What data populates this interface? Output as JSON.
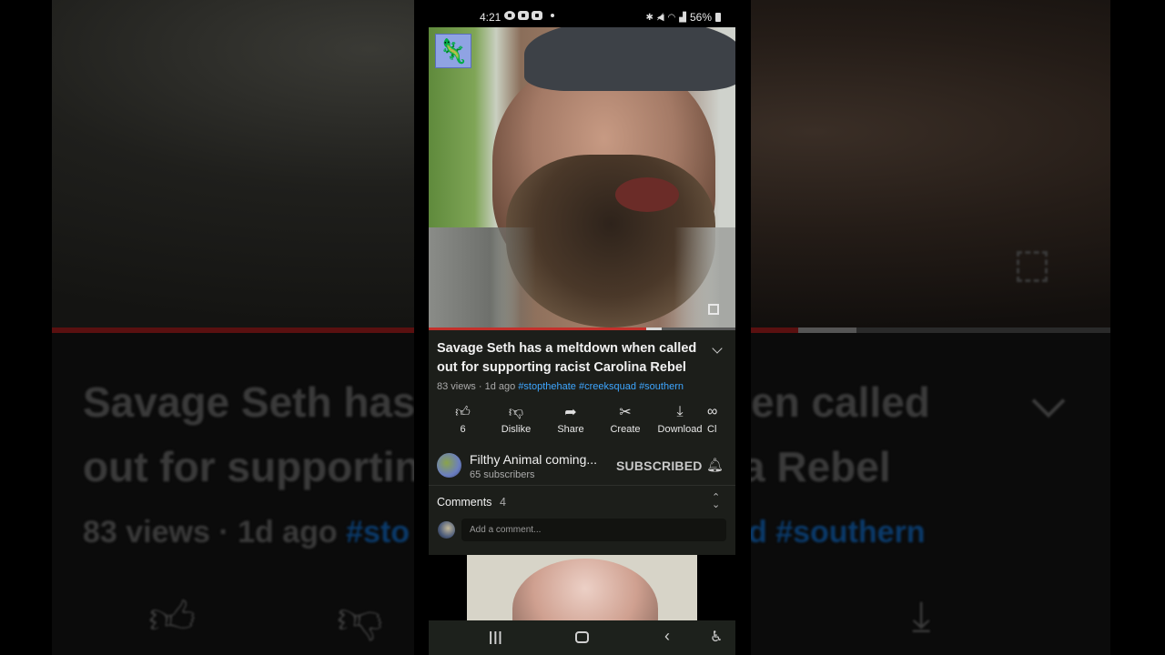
{
  "status_bar": {
    "time": "4:21",
    "battery": "56%",
    "icons": [
      "bluetooth-icon",
      "mute-icon",
      "wifi-icon",
      "signal-icon",
      "battery-icon"
    ]
  },
  "video": {
    "progress_fraction": 0.71,
    "buffered_fraction": 0.76,
    "channel_watermark": "cartoon-animal-logo"
  },
  "title": "Savage Seth has a meltdown when called out for supporting racist Carolina Rebel",
  "meta": {
    "views": "83 views",
    "separator": "·",
    "age": "1d ago",
    "hashtags": [
      "#stopthehate",
      "#creeksquad",
      "#southern"
    ]
  },
  "actions": [
    {
      "name": "like",
      "label": "6",
      "icon": "thumbs-up-icon"
    },
    {
      "name": "dislike",
      "label": "Dislike",
      "icon": "thumbs-down-icon"
    },
    {
      "name": "share",
      "label": "Share",
      "icon": "share-icon"
    },
    {
      "name": "create",
      "label": "Create",
      "icon": "create-icon"
    },
    {
      "name": "download",
      "label": "Download",
      "icon": "download-icon"
    },
    {
      "name": "clip",
      "label": "Cl",
      "icon": "clip-icon"
    }
  ],
  "channel": {
    "name": "Filthy Animal coming...",
    "subscribers": "65 subscribers",
    "subscribe_state": "SUBSCRIBED"
  },
  "comments": {
    "label": "Comments",
    "count": "4",
    "placeholder": "Add a comment..."
  },
  "background": {
    "title_line1": "Savage Seth has",
    "title_line2": "out for supportin",
    "meta_prefix": "83 views · 1d ago ",
    "meta_tag_left": "#sto",
    "title_right1": "en called",
    "title_right2": "a Rebel",
    "meta_tag_right": "d #southern"
  },
  "colors": {
    "accent_red": "#c4302b",
    "hashtag_blue": "#3ea6ff",
    "panel_bg": "#1c1e1a"
  }
}
